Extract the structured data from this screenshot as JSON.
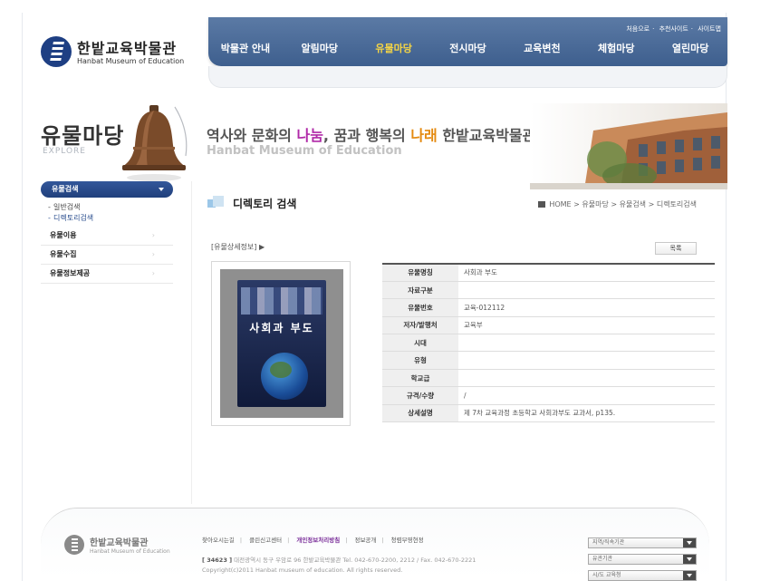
{
  "site": {
    "logo_ko": "한밭교육박물관",
    "logo_en": "Hanbat Museum of Education"
  },
  "util_links": [
    "처음으로",
    "추천사이트",
    "사이트맵"
  ],
  "gnb": {
    "items": [
      {
        "label": "박물관 안내",
        "active": false
      },
      {
        "label": "알림마당",
        "active": false
      },
      {
        "label": "유물마당",
        "active": true
      },
      {
        "label": "전시마당",
        "active": false
      },
      {
        "label": "교육변천",
        "active": false
      },
      {
        "label": "체험마당",
        "active": false
      },
      {
        "label": "열린마당",
        "active": false
      }
    ],
    "active_color": "#f6d544"
  },
  "visual": {
    "section_title": "유물마당",
    "section_sub": "EXPLORE",
    "slogan_parts": [
      "역사와 문화의 ",
      "나눔",
      ", 꿈과 행복의 ",
      "나래",
      " 한밭교육박물관"
    ],
    "slogan_en": "Hanbat Museum of Education"
  },
  "lnb": {
    "head": "유물검색",
    "subs": [
      {
        "label": "일반검색",
        "active": false
      },
      {
        "label": "디렉토리검색",
        "active": true
      }
    ],
    "items": [
      "유물이용",
      "유물수집",
      "유물정보제공"
    ]
  },
  "content": {
    "title": "디렉토리 검색",
    "breadcrumb": "HOME > 유물마당 > 유물검색 > 디렉토리검색",
    "detail_label": "[유물상세정보] ▶",
    "list_button": "목록",
    "book_title": "사회과 부도",
    "rows": [
      {
        "th": "유물명칭",
        "td": "사회과 부도"
      },
      {
        "th": "자료구분",
        "td": ""
      },
      {
        "th": "유물번호",
        "td": "교육-012112"
      },
      {
        "th": "저자/발행처",
        "td": "교육부"
      },
      {
        "th": "시대",
        "td": ""
      },
      {
        "th": "유형",
        "td": ""
      },
      {
        "th": "학교급",
        "td": ""
      },
      {
        "th": "규격/수량",
        "td": "/"
      },
      {
        "th": "상세설명",
        "td": "제 7차 교육과정 초등학교 사회과부도 교과서, p135."
      }
    ]
  },
  "footer": {
    "logo_ko": "한밭교육박물관",
    "logo_en": "Hanbat Museum of Education",
    "links": [
      {
        "label": "찾아오시는길",
        "highlight": false
      },
      {
        "label": "클린신고센터",
        "highlight": false
      },
      {
        "label": "개인정보처리방침",
        "highlight": true
      },
      {
        "label": "정보공개",
        "highlight": false
      },
      {
        "label": "청렴부영현정",
        "highlight": false
      }
    ],
    "zip": "[ 34623 ]",
    "address": "대전광역시 동구 우암로 96 한밭교육박물관  Tel. 042-670-2200, 2212 / Fax. 042-670-2221",
    "copyright": "Copyright(c)2011 Hanbat museum of education. All rights reserved.",
    "selects": [
      "지역/직속기관",
      "유관기관",
      "시/도 교육청"
    ]
  }
}
